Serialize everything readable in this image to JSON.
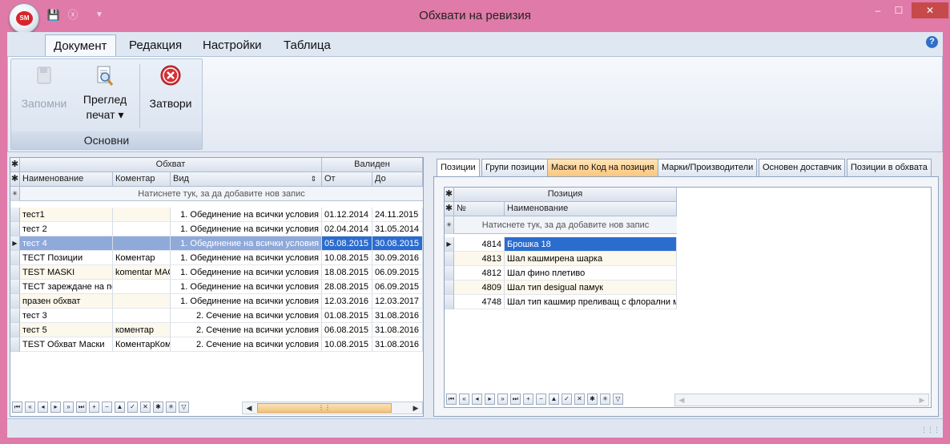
{
  "window": {
    "title": "Обхвати на ревизия",
    "app_logo": "SM"
  },
  "ribbon": {
    "tabs": [
      "Документ",
      "Редакция",
      "Настройки",
      "Таблица"
    ],
    "group_label": "Основни",
    "buttons": {
      "save": "Запомни",
      "preview_line1": "Преглед",
      "preview_line2": "печат ▾",
      "close": "Затвори"
    }
  },
  "left_grid": {
    "band_main": "Обхват",
    "band_valid": "Валиден",
    "columns": [
      "Наименование",
      "Коментар",
      "Вид",
      "От",
      "До"
    ],
    "new_row_hint": "Натиснете тук, за да добавите нов запис",
    "rows": [
      {
        "name": "тест1",
        "comment": "",
        "kind": "1. Обединение на всички условия",
        "from": "01.12.2014",
        "to": "24.11.2015"
      },
      {
        "name": "тест 2",
        "comment": "",
        "kind": "1. Обединение на всички условия",
        "from": "02.04.2014",
        "to": "31.05.2014"
      },
      {
        "name": "тест 4",
        "comment": "",
        "kind": "1. Обединение на всички условия",
        "from": "05.08.2015",
        "to": "30.08.2015"
      },
      {
        "name": "ТЕСТ Позиции",
        "comment": "Коментар",
        "kind": "1. Обединение на всички условия",
        "from": "10.08.2015",
        "to": "30.09.2016"
      },
      {
        "name": "TEST MASKI",
        "comment": "komentar MAC",
        "kind": "1. Обединение на всички условия",
        "from": "18.08.2015",
        "to": "06.09.2015"
      },
      {
        "name": "ТЕСТ зареждане на по",
        "comment": "",
        "kind": "1. Обединение на всички условия",
        "from": "28.08.2015",
        "to": "06.09.2015"
      },
      {
        "name": "празен обхват",
        "comment": "",
        "kind": "1. Обединение на всички условия",
        "from": "12.03.2016",
        "to": "12.03.2017"
      },
      {
        "name": "тест 3",
        "comment": "",
        "kind": "2. Сечение на всички условия",
        "from": "01.08.2015",
        "to": "31.08.2016"
      },
      {
        "name": "тест 5",
        "comment": "коментар",
        "kind": "2. Сечение на всички условия",
        "from": "06.08.2015",
        "to": "31.08.2016"
      },
      {
        "name": "TEST Обхват Маски",
        "comment": "КоментарКом",
        "kind": "2. Сечение на всички условия",
        "from": "10.08.2015",
        "to": "31.08.2016"
      }
    ]
  },
  "right_panel": {
    "tabs": [
      "Позиции",
      "Групи позиции",
      "Маски по Код на позиция",
      "Марки/Производители",
      "Основен доставчик",
      "Позиции в обхвата"
    ],
    "grid": {
      "band": "Позиция",
      "columns": [
        "№",
        "Наименование"
      ],
      "new_row_hint": "Натиснете тук, за да добавите нов запис",
      "rows": [
        {
          "no": "4814",
          "name": "Брошка 18"
        },
        {
          "no": "4813",
          "name": "Шал кашмирена шарка"
        },
        {
          "no": "4812",
          "name": "Шал фино плетиво"
        },
        {
          "no": "4809",
          "name": "Шал тип desigual памук"
        },
        {
          "no": "4748",
          "name": "Шал тип кашмир преливащ с флорални мотиви"
        }
      ]
    }
  },
  "nav_glyphs": [
    "⏮",
    "«",
    "◂",
    "▸",
    "»",
    "⏭",
    "+",
    "−",
    "▲",
    "✓",
    "✕",
    "✱",
    "✳",
    "▽"
  ],
  "colors": {
    "title_bar": "#e07aa8",
    "selected_row": "#2b6ccf",
    "selected_row_inactive": "#8fa9d9",
    "alt_row": "#fdf8ec"
  }
}
